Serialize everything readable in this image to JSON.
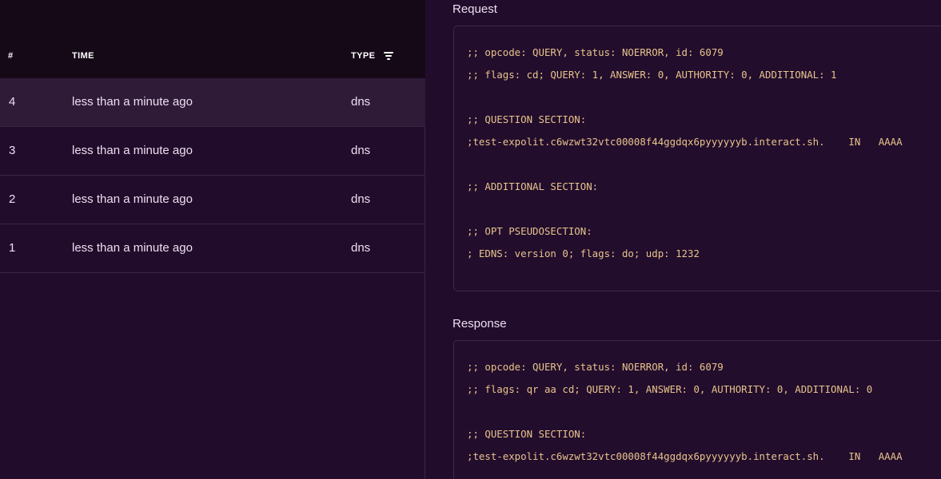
{
  "table": {
    "headers": {
      "num": "#",
      "time": "TIME",
      "type": "TYPE"
    },
    "rows": [
      {
        "num": "4",
        "time": "less than a minute ago",
        "type": "dns"
      },
      {
        "num": "3",
        "time": "less than a minute ago",
        "type": "dns"
      },
      {
        "num": "2",
        "time": "less than a minute ago",
        "type": "dns"
      },
      {
        "num": "1",
        "time": "less than a minute ago",
        "type": "dns"
      }
    ]
  },
  "detail": {
    "request": {
      "title": "Request",
      "lines": [
        ";; opcode: QUERY, status: NOERROR, id: 6079",
        ";; flags: cd; QUERY: 1, ANSWER: 0, AUTHORITY: 0, ADDITIONAL: 1",
        "",
        ";; QUESTION SECTION:",
        ";test-expolit.c6wzwt32vtc00008f44ggdqx6pyyyyyyb.interact.sh.    IN   AAAA",
        "",
        ";; ADDITIONAL SECTION:",
        "",
        ";; OPT PSEUDOSECTION:",
        "; EDNS: version 0; flags: do; udp: 1232"
      ]
    },
    "response": {
      "title": "Response",
      "lines": [
        ";; opcode: QUERY, status: NOERROR, id: 6079",
        ";; flags: qr aa cd; QUERY: 1, ANSWER: 0, AUTHORITY: 0, ADDITIONAL: 0",
        "",
        ";; QUESTION SECTION:",
        ";test-expolit.c6wzwt32vtc00008f44ggdqx6pyyyyyyb.interact.sh.    IN   AAAA"
      ]
    }
  },
  "icons": {
    "type_filter": "filter-icon"
  },
  "colors": {
    "background": "#220c2c",
    "header_background": "#150917",
    "selected_row": "#2f1a38",
    "code_text": "#e6c48a"
  }
}
